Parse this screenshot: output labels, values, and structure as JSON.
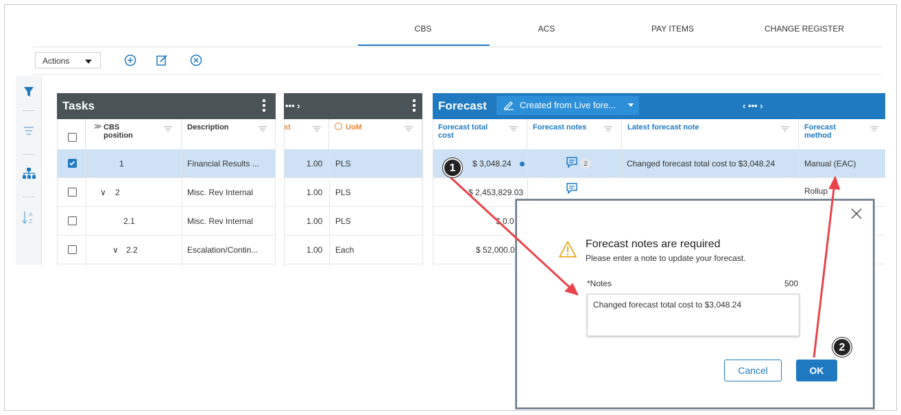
{
  "tabs": [
    "CBS",
    "ACS",
    "PAY ITEMS",
    "CHANGE REGISTER"
  ],
  "active_tab": "CBS",
  "toolbar": {
    "actions_label": "Actions"
  },
  "tasks": {
    "title": "Tasks",
    "columns": [
      "CBS position",
      "Description"
    ],
    "rows": [
      {
        "position": "1",
        "description": "Financial Results ...",
        "checked": true,
        "expand": ""
      },
      {
        "position": "2",
        "description": "Misc. Rev Internal",
        "checked": false,
        "expand": "∨"
      },
      {
        "position": "2.1",
        "description": "Misc. Rev Internal",
        "checked": false,
        "expand": ""
      },
      {
        "position": "2.2",
        "description": "Escalation/Contin...",
        "checked": false,
        "expand": "∨"
      }
    ]
  },
  "mid": {
    "nav": "••• ›",
    "col_partial": "st",
    "col_uom": "UoM",
    "rows": [
      {
        "qty": "1.00",
        "uom": "PLS"
      },
      {
        "qty": "1.00",
        "uom": "PLS"
      },
      {
        "qty": "1.00",
        "uom": "PLS"
      },
      {
        "qty": "1.00",
        "uom": "Each"
      }
    ]
  },
  "forecast": {
    "title": "Forecast",
    "view_label": "Created from Live fore...",
    "nav": "‹ ••• ›",
    "columns": [
      "Forecast total cost",
      "Forecast notes",
      "Latest forecast note",
      "Forecast method"
    ],
    "rows": [
      {
        "cost": "$ 3,048.24",
        "notes_count": "2",
        "latest_note": "Changed forecast total cost to $3,048.24",
        "method": "Manual (EAC)"
      },
      {
        "cost": "$ 2,453,829.03",
        "notes_count": "",
        "latest_note": "",
        "method": "Rollup"
      },
      {
        "cost": "$ 0.0",
        "notes_count": "",
        "latest_note": "",
        "method": ""
      },
      {
        "cost": "$ 52,000.0",
        "notes_count": "",
        "latest_note": "",
        "method": ""
      }
    ]
  },
  "modal": {
    "title": "Forecast notes are required",
    "message": "Please enter a note to update your forecast.",
    "notes_label": "*Notes",
    "notes_limit": "500",
    "notes_value": "Changed forecast total cost to $3,048.24",
    "cancel_label": "Cancel",
    "ok_label": "OK"
  },
  "callouts": [
    "1",
    "2"
  ],
  "colors": {
    "accent": "#1f7ac2",
    "header_dark": "#4a5457",
    "selected_row": "#cfe2f5",
    "annotation": "#e8434b"
  }
}
